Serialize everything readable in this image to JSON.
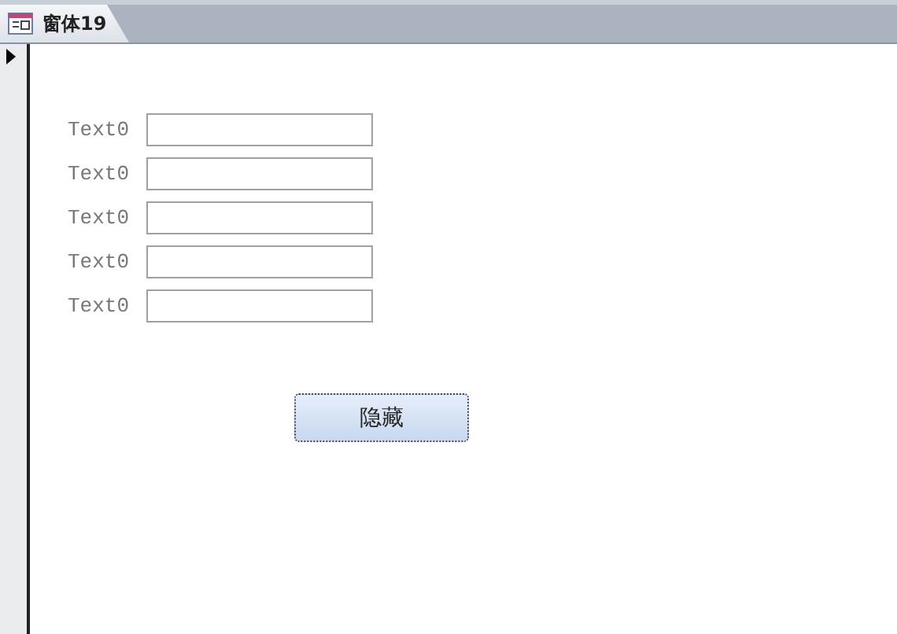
{
  "tab": {
    "title": "窗体19"
  },
  "fields": [
    {
      "label": "Text0"
    },
    {
      "label": "Text0"
    },
    {
      "label": "Text0"
    },
    {
      "label": "Text0"
    },
    {
      "label": "Text0"
    }
  ],
  "button": {
    "label": "隐藏"
  }
}
